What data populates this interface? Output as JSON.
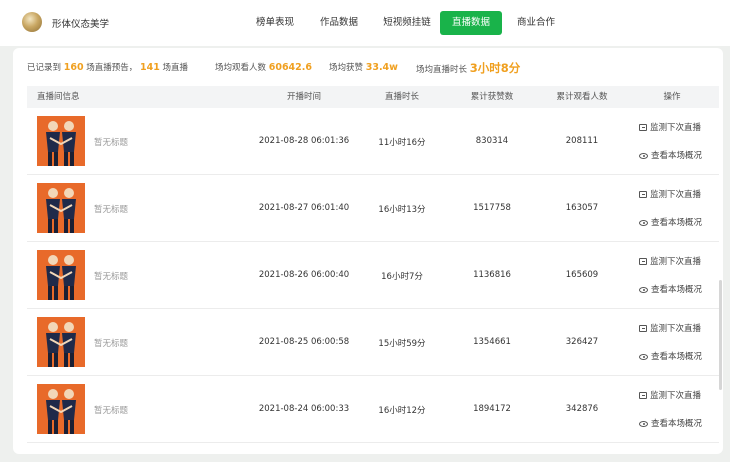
{
  "account": {
    "name": "形体仪态美学"
  },
  "nav": [
    {
      "label": "榜单表现",
      "active": false
    },
    {
      "label": "作品数据",
      "active": false
    },
    {
      "label": "短视频挂链",
      "active": false
    },
    {
      "label": "直播数据",
      "active": true
    },
    {
      "label": "商业合作",
      "active": false
    }
  ],
  "summary": {
    "recorded_prefix": "已记录到",
    "preview_count": "160",
    "preview_suffix": "场直播预告，",
    "live_count": "141",
    "live_suffix": "场直播",
    "avg_viewers_label": "场均观看人数",
    "avg_viewers": "60642.6",
    "avg_likes_label": "场均获赞",
    "avg_likes": "33.4w",
    "avg_duration_label": "场均直播时长",
    "avg_duration": "3小时8分"
  },
  "table": {
    "columns": [
      "直播间信息",
      "开播时间",
      "直播时长",
      "累计获赞数",
      "累计观看人数",
      "操作"
    ],
    "actions": {
      "monitor": "监测下次直播",
      "view": "查看本场概况"
    },
    "rows": [
      {
        "title": "暂无标题",
        "start": "2021-08-28 06:01:36",
        "duration": "11小时16分",
        "likes": "830314",
        "viewers": "208111"
      },
      {
        "title": "暂无标题",
        "start": "2021-08-27 06:01:40",
        "duration": "16小时13分",
        "likes": "1517758",
        "viewers": "163057"
      },
      {
        "title": "暂无标题",
        "start": "2021-08-26 06:00:40",
        "duration": "16小时7分",
        "likes": "1136816",
        "viewers": "165609"
      },
      {
        "title": "暂无标题",
        "start": "2021-08-25 06:00:58",
        "duration": "15小时59分",
        "likes": "1354661",
        "viewers": "326427"
      },
      {
        "title": "暂无标题",
        "start": "2021-08-24 06:00:33",
        "duration": "16小时12分",
        "likes": "1894172",
        "viewers": "342876"
      }
    ]
  },
  "colors": {
    "accent": "#19b34a",
    "highlight": "#f0a020",
    "thumb_bg": "#e86a2a"
  }
}
